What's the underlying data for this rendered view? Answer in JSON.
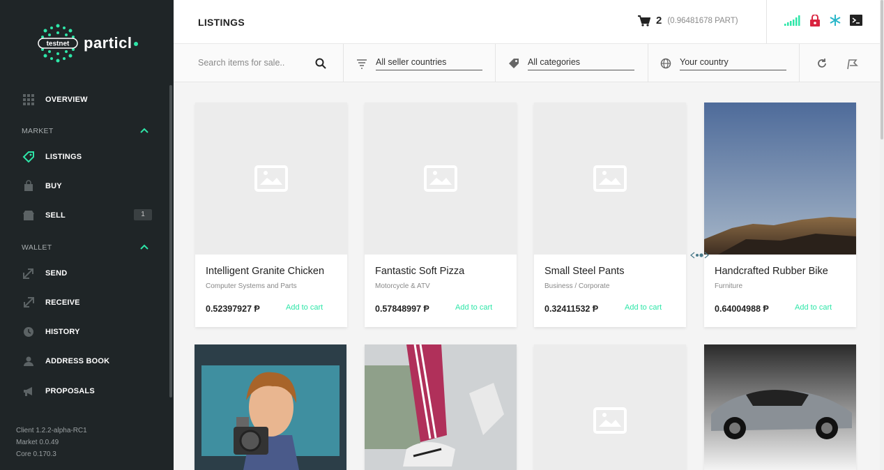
{
  "sidebar": {
    "logo_badge": "testnet",
    "logo_text": "particl",
    "items": [
      {
        "label": "OVERVIEW"
      },
      {
        "label": "LISTINGS"
      },
      {
        "label": "BUY"
      },
      {
        "label": "SELL",
        "badge": "1"
      },
      {
        "label": "SEND"
      },
      {
        "label": "RECEIVE"
      },
      {
        "label": "HISTORY"
      },
      {
        "label": "ADDRESS BOOK"
      },
      {
        "label": "PROPOSALS"
      }
    ],
    "sections": {
      "market": "MARKET",
      "wallet": "WALLET"
    },
    "versions": {
      "client": "Client  1.2.2-alpha-RC1",
      "market": "Market  0.0.49",
      "core": "Core  0.170.3"
    }
  },
  "header": {
    "title": "LISTINGS",
    "cart_count": "2",
    "cart_balance": "(0.96481678 PART)"
  },
  "filters": {
    "search_placeholder": "Search items for sale..",
    "seller_countries": "All seller countries",
    "categories": "All categories",
    "country": "Your country"
  },
  "listings": [
    {
      "title": "Intelligent Granite Chicken",
      "category": "Computer Systems and Parts",
      "price": "0.52397927 Ᵽ",
      "action": "Add to cart"
    },
    {
      "title": "Fantastic Soft Pizza",
      "category": "Motorcycle & ATV",
      "price": "0.57848997 Ᵽ",
      "action": "Add to cart"
    },
    {
      "title": "Small Steel Pants",
      "category": "Business / Corporate",
      "price": "0.32411532 Ᵽ",
      "action": "Add to cart"
    },
    {
      "title": "Handcrafted Rubber Bike",
      "category": "Furniture",
      "price": "0.64004988 Ᵽ",
      "action": "Add to cart"
    }
  ],
  "colors": {
    "accent": "#2ee6a8",
    "sidebar_bg": "#1f2527",
    "lock": "#d9243f"
  }
}
